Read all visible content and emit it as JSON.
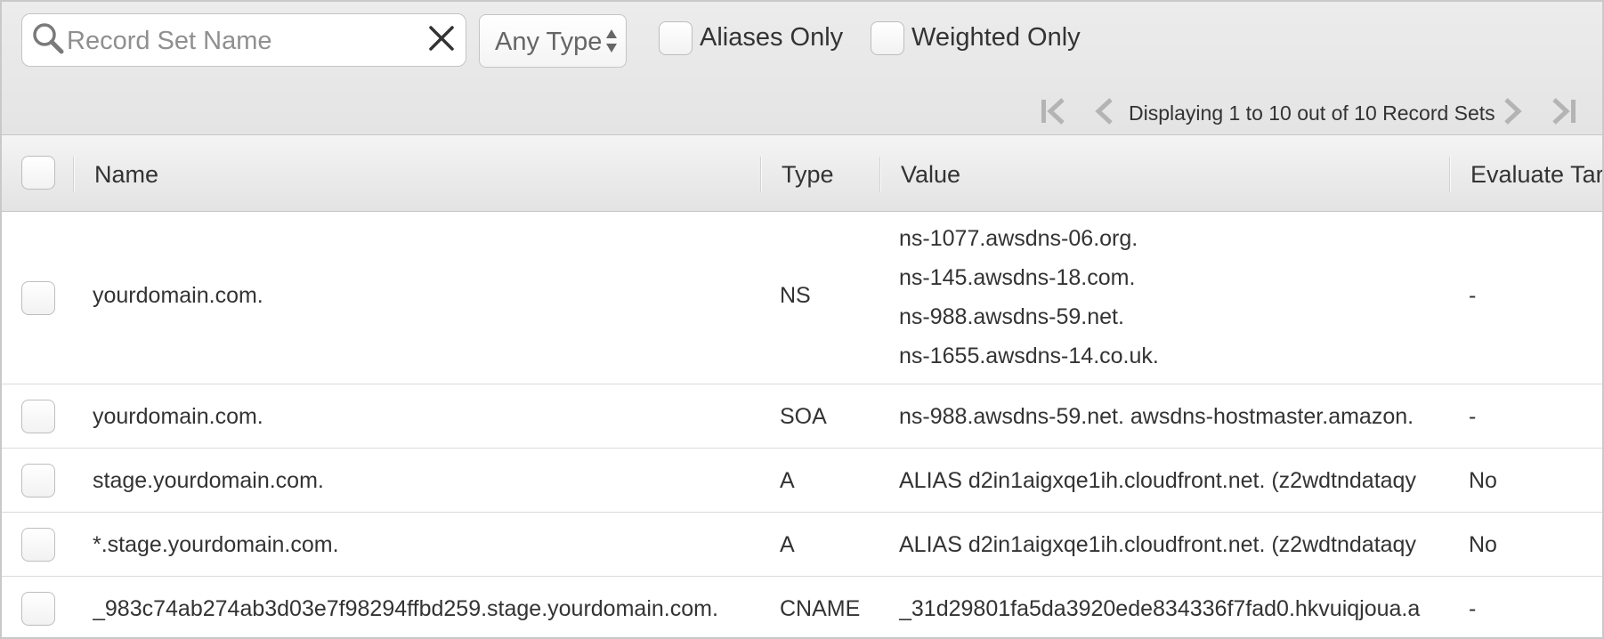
{
  "filters": {
    "search_placeholder": "Record Set Name",
    "type_selected": "Any Type",
    "aliases_only_label": "Aliases Only",
    "weighted_only_label": "Weighted Only"
  },
  "pager": {
    "text": "Displaying 1 to 10 out of 10 Record Sets"
  },
  "columns": {
    "name": "Name",
    "type": "Type",
    "value": "Value",
    "evaluate": "Evaluate Targ"
  },
  "rows": [
    {
      "name": "yourdomain.com.",
      "type": "NS",
      "values": [
        "ns-1077.awsdns-06.org.",
        "ns-145.awsdns-18.com.",
        "ns-988.awsdns-59.net.",
        "ns-1655.awsdns-14.co.uk."
      ],
      "evaluate": "-"
    },
    {
      "name": "yourdomain.com.",
      "type": "SOA",
      "values": [
        "ns-988.awsdns-59.net. awsdns-hostmaster.amazon."
      ],
      "evaluate": "-"
    },
    {
      "name": "stage.yourdomain.com.",
      "type": "A",
      "values": [
        "ALIAS d2in1aigxqe1ih.cloudfront.net. (z2wdtndataqy"
      ],
      "evaluate": "No"
    },
    {
      "name": "*.stage.yourdomain.com.",
      "type": "A",
      "values": [
        "ALIAS d2in1aigxqe1ih.cloudfront.net. (z2wdtndataqy"
      ],
      "evaluate": "No"
    },
    {
      "name": "_983c74ab274ab3d03e7f98294ffbd259.stage.yourdomain.com.",
      "type": "CNAME",
      "values": [
        "_31d29801fa5da3920ede834336f7fad0.hkvuiqjoua.a"
      ],
      "evaluate": "-"
    }
  ]
}
